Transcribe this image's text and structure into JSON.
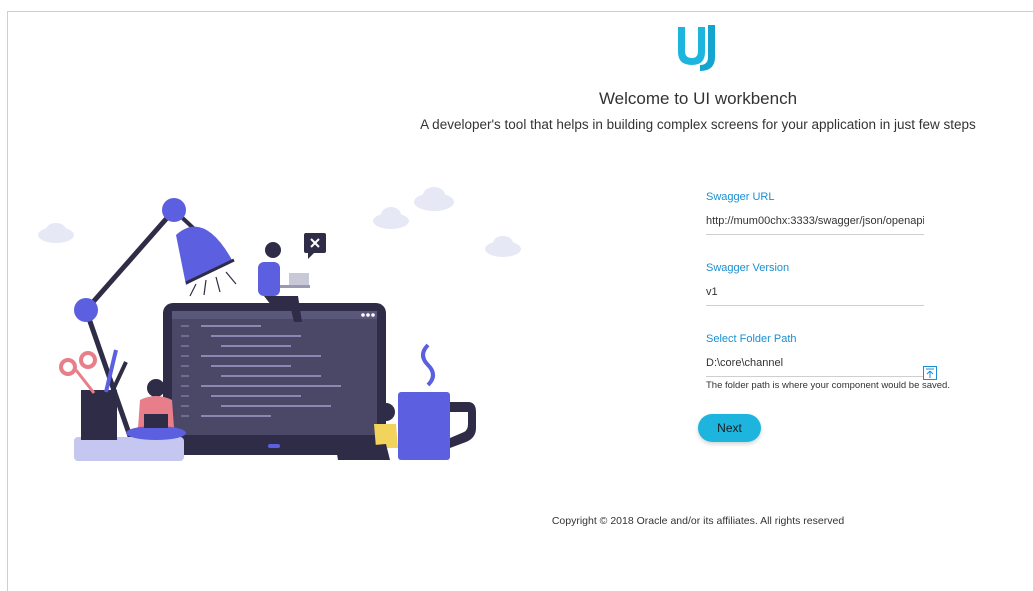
{
  "header": {
    "logo_icon": "uj-logo-icon",
    "title": "Welcome to UI workbench",
    "subtitle": "A developer's tool that helps in building complex screens for your application in just few steps"
  },
  "illustration": {
    "icon": "developer-workspace-illustration"
  },
  "form": {
    "swagger_url": {
      "label": "Swagger URL",
      "value": "http://mum00chx:3333/swagger/json/openapi"
    },
    "swagger_version": {
      "label": "Swagger Version",
      "value": "v1"
    },
    "folder_path": {
      "label": "Select Folder Path",
      "value": "D:\\core\\channel",
      "hint": "The folder path is where your component would be saved.",
      "icon": "folder-upload-icon"
    },
    "next_label": "Next"
  },
  "footer": {
    "copyright": "Copyright © 2018 Oracle and/or its affiliates. All rights reserved"
  },
  "colors": {
    "accent": "#1a8fd1",
    "button": "#1db5de",
    "illustration_primary": "#5b5fe0",
    "illustration_dark": "#2f2c47"
  }
}
